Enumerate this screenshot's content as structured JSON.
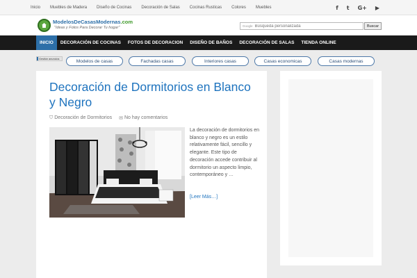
{
  "topbar": {
    "links": [
      "Inicio",
      "Muebles de Madera",
      "Diseño de Cocinas",
      "Decoración de Salas",
      "Cocinas Rusticas",
      "Colores",
      "Muebles"
    ],
    "social": [
      {
        "icon": "facebook-icon",
        "glyph": "f"
      },
      {
        "icon": "twitter-icon",
        "glyph": "t"
      },
      {
        "icon": "google-plus-icon",
        "glyph": "G+"
      },
      {
        "icon": "youtube-icon",
        "glyph": "▶"
      }
    ]
  },
  "header": {
    "logo_main": "ModelosDeCasasModernas",
    "logo_tld": ".com",
    "tagline": "\"Ideas y Fotos Para Decorar Tu hogar\"",
    "search_provider": "Google",
    "search_placeholder": "Búsqueda personalizada",
    "search_button": "Buscar"
  },
  "nav": {
    "items": [
      "Inicio",
      "Decoración de Cocinas",
      "Fotos de Decoracion",
      "Diseño de Baños",
      "Decoración de Salas",
      "Tienda Online"
    ],
    "active_index": 0
  },
  "ads": {
    "badge": "Gestión anuncios",
    "pills": [
      "Modelos de casas",
      "Fachadas casas",
      "Interiores casas",
      "Casas economicas",
      "Casas modernas"
    ]
  },
  "article": {
    "title": "Decoración de Dormitorios en Blanco y Negro",
    "category": "Decoración de Dormitorios",
    "comments": "No hay comentarios",
    "excerpt": "La decoración de dormitorios en blanco y negro es un estilo relativamente fácil, sencillo y elegante. Este tipo de decoración accede contribuir al dormitorio un aspecto limpio, contemporáneo y …",
    "read_more": "[Leer Más…]"
  },
  "colors": {
    "accent": "#1e73be",
    "nav_bg": "#1a1a1a",
    "nav_active": "#2d6fa8",
    "page_bg": "#ececec"
  }
}
